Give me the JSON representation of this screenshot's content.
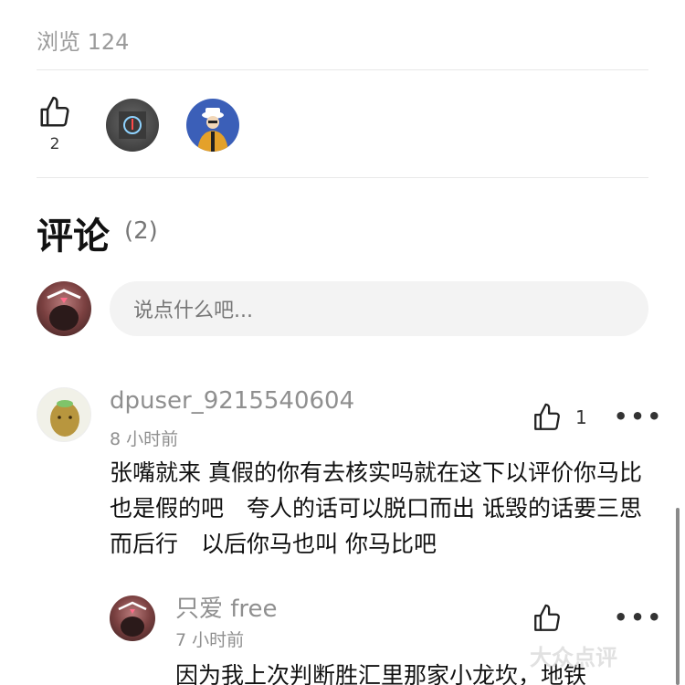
{
  "views": {
    "label": "浏览 124"
  },
  "likes": {
    "count": "2"
  },
  "comments_header": {
    "title": "评论",
    "count": "(2)"
  },
  "input": {
    "placeholder": "说点什么吧..."
  },
  "comments": [
    {
      "author": "dpuser_9215540604",
      "time": "8 小时前",
      "likes": "1",
      "body": "张嘴就来 真假的你有去核实吗就在这下以评价你马比也是假的吧　夸人的话可以脱口而出 诋毁的话要三思而后行　以后你马也叫 你马比吧"
    },
    {
      "author": "只爱 free",
      "time": "7 小时前",
      "likes": "",
      "body": "因为我上次判断胜汇里那家小龙坎，地铁"
    }
  ],
  "watermark": "大众点评",
  "colors": {
    "text_primary": "#111111",
    "text_secondary": "#8f8f8f",
    "input_bg": "#f3f3f3"
  },
  "icons": [
    "thumbs-up-icon",
    "more-icon"
  ]
}
